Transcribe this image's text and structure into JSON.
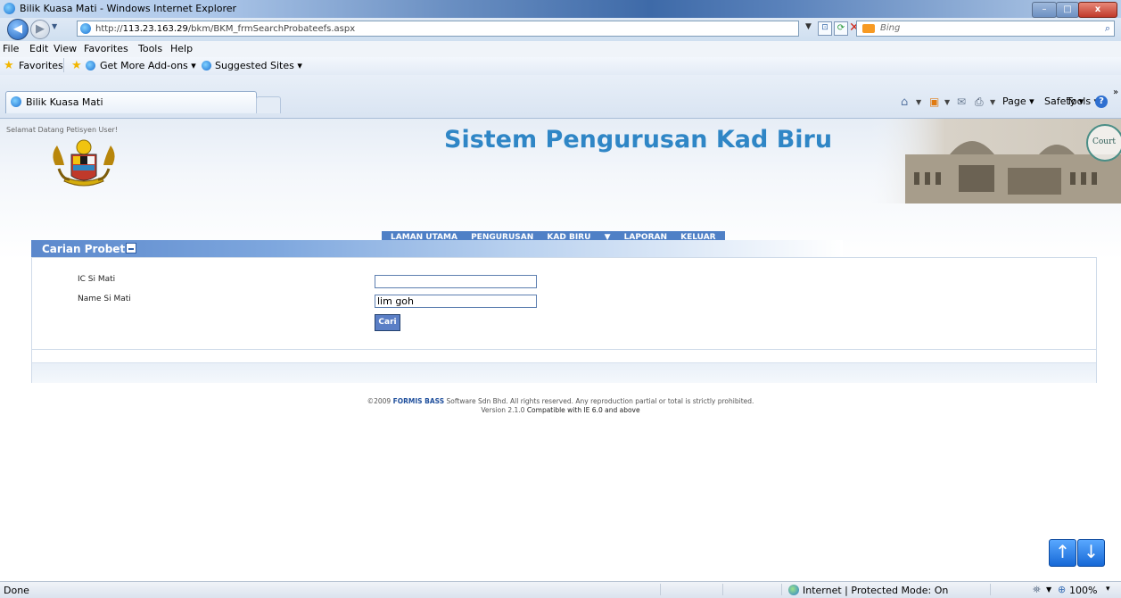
{
  "window": {
    "title": "Bilik Kuasa Mati - Windows Internet Explorer",
    "minimize": "–",
    "maximize": "□",
    "close": "x"
  },
  "address_bar": {
    "url_prefix": "http://",
    "url_host": "113.23.163.29",
    "url_path": "/bkm/BKM_frmSearchProbateefs.aspx",
    "search_placeholder": "Bing",
    "back": "◀",
    "forward": "▶"
  },
  "menu": [
    "File",
    "Edit",
    "View",
    "Favorites",
    "Tools",
    "Help"
  ],
  "favorites_bar": {
    "favorites": "Favorites",
    "get_addons": "Get More Add-ons ▾",
    "suggested_sites": "Suggested Sites ▾"
  },
  "tab": {
    "label": "Bilik Kuasa Mati"
  },
  "command_bar": {
    "page": "Page ▾",
    "safety": "Safety ▾",
    "tools": "Tools ▾",
    "more": "»"
  },
  "page": {
    "welcome": "Selamat Datang Petisyen User!",
    "system_title": "Sistem Pengurusan Kad Biru",
    "court_badge": "Court",
    "nav": [
      "LAMAN UTAMA",
      "PENGURUSAN",
      "KAD BIRU",
      "▼",
      "LAPORAN",
      "KELUAR"
    ],
    "section_title": "Carian Probet",
    "form": {
      "ic_label": "IC Si Mati",
      "ic_value": "",
      "name_label": "Name Si Mati",
      "name_value": "lim goh",
      "search_button": "Cari"
    },
    "footer": {
      "line1_prefix": "©2009",
      "company": "FORMIS BASS",
      "line1_suffix": "Software Sdn Bhd. All rights reserved. Any reproduction partial or total is strictly prohibited.",
      "line2_prefix": "Version 2.1.0",
      "line2_suffix": "Compatible with IE 6.0 and above"
    },
    "scroll_up": "↑",
    "scroll_down": "↓"
  },
  "status_bar": {
    "status": "Done",
    "zone": "Internet | Protected Mode: On",
    "zoom": "100%",
    "zoom_arrow": "▾"
  }
}
